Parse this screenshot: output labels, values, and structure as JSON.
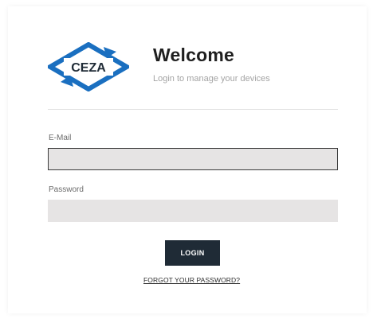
{
  "brand": {
    "logo_text": "CEZA",
    "logo_color": "#1a6fc0"
  },
  "header": {
    "title": "Welcome",
    "subtitle": "Login to manage your devices"
  },
  "form": {
    "email_label": "E-Mail",
    "email_value": "",
    "password_label": "Password",
    "password_value": "",
    "login_label": "LOGIN",
    "forgot_label": "FORGOT YOUR PASSWORD?"
  },
  "colors": {
    "button_bg": "#1f2b36",
    "input_bg": "#e6e4e4"
  }
}
